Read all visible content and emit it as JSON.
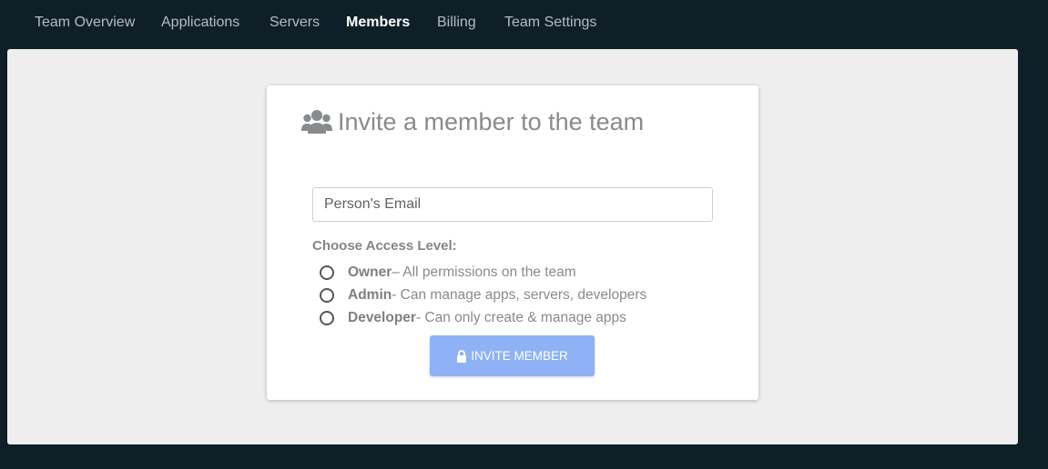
{
  "nav": {
    "items": [
      {
        "label": "Team Overview"
      },
      {
        "label": "Applications"
      },
      {
        "label": "Servers"
      },
      {
        "label": "Members"
      },
      {
        "label": "Billing"
      },
      {
        "label": "Team Settings"
      }
    ],
    "active": "Members"
  },
  "card": {
    "icon": "users-icon",
    "title": "Invite a member to the team",
    "email_placeholder": "Person's Email",
    "access_label": "Choose Access Level:",
    "options": [
      {
        "name": "Owner",
        "description": " – All permissions on the team"
      },
      {
        "name": "Admin",
        "description": " - Can manage apps, servers, developers"
      },
      {
        "name": "Developer",
        "description": " - Can only create & manage apps"
      }
    ],
    "button": {
      "icon": "lock-icon",
      "label": "INVITE MEMBER"
    }
  },
  "colors": {
    "background": "#0f1f28",
    "panel": "#eeeeee",
    "button": "#8fb1f5",
    "nav_text": "#b5bcc1",
    "nav_active": "#ffffff"
  }
}
